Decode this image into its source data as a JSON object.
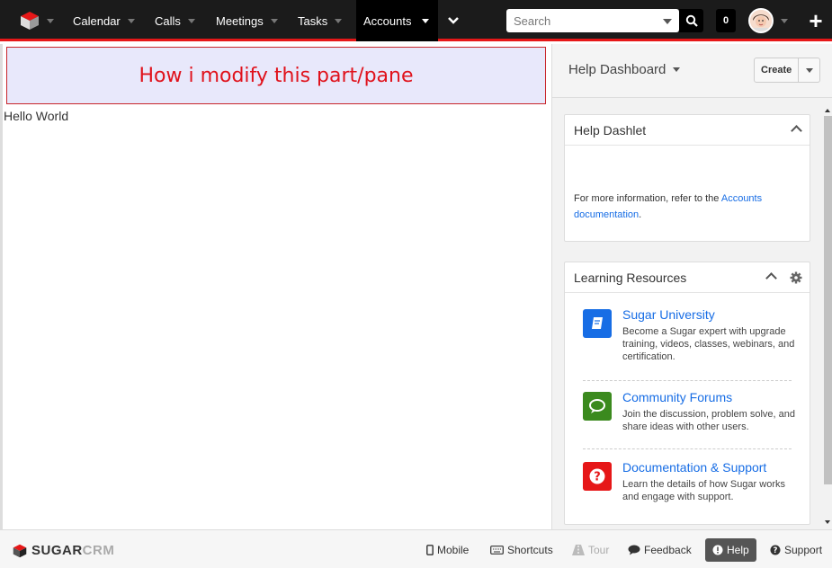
{
  "nav": {
    "items": [
      {
        "label": "Calendar"
      },
      {
        "label": "Calls"
      },
      {
        "label": "Meetings"
      },
      {
        "label": "Tasks"
      },
      {
        "label": "Accounts",
        "active": true
      }
    ],
    "search_placeholder": "Search",
    "notification_count": "0",
    "plus_label": "+"
  },
  "main": {
    "banner_text": "How i modify this part/pane",
    "hello_text": "Hello World"
  },
  "sidebar": {
    "dashboard_title": "Help Dashboard",
    "create_label": "Create",
    "help_dashlet": {
      "title": "Help Dashlet",
      "text_before": "For more information, refer to the ",
      "link_text": "Accounts documentation",
      "text_after": "."
    },
    "learning": {
      "title": "Learning Resources",
      "items": [
        {
          "title": "Sugar University",
          "desc": "Become a Sugar expert with upgrade training, videos, classes, webinars, and certification.",
          "icon": "book-icon",
          "color": "#176de5"
        },
        {
          "title": "Community Forums",
          "desc": "Join the discussion, problem solve, and share ideas with other users.",
          "icon": "chat-icon",
          "color": "#3b8a1e"
        },
        {
          "title": "Documentation & Support",
          "desc": "Learn the details of how Sugar works and engage with support.",
          "icon": "question-icon",
          "color": "#e61718"
        }
      ]
    }
  },
  "footer": {
    "brand_a": "SUGAR",
    "brand_b": "CRM",
    "mobile": "Mobile",
    "shortcuts": "Shortcuts",
    "tour": "Tour",
    "feedback": "Feedback",
    "help": "Help",
    "support": "Support"
  },
  "colors": {
    "accent_red": "#e61718",
    "nav_bg": "#1b1b1b",
    "link_blue": "#176de5"
  }
}
